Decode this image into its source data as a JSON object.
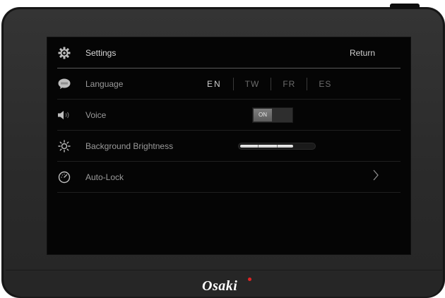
{
  "header": {
    "title": "Settings",
    "return_label": "Return",
    "icon": "gear-icon"
  },
  "rows": {
    "language": {
      "label": "Language",
      "icon": "speech-bubble-abc-icon",
      "options": [
        "EN",
        "TW",
        "FR",
        "ES"
      ],
      "selected": "EN"
    },
    "voice": {
      "label": "Voice",
      "icon": "speaker-icon",
      "toggle_label": "ON",
      "enabled": true
    },
    "brightness": {
      "label": "Background Brightness",
      "icon": "sun-icon",
      "level": 0.72
    },
    "autolock": {
      "label": "Auto-Lock",
      "icon": "timer-icon",
      "chevron": "chevron-right-icon"
    }
  },
  "device": {
    "brand": "Osaki",
    "brand_dot_color": "#e02424"
  },
  "colors": {
    "screen_bg": "#050505",
    "bezel": "#2c2c2c",
    "text_active": "#cfcfcf",
    "text_dim": "#6c6c6c"
  }
}
